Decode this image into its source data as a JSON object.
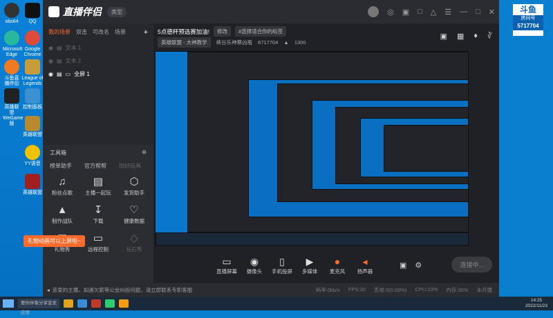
{
  "app": {
    "name": "直播伴侣",
    "type_chip": "类型"
  },
  "desktop_icons": [
    {
      "label": "obs64"
    },
    {
      "label": "QQ"
    },
    {
      "label": "Microsoft Edge"
    },
    {
      "label": "Google Chrome"
    },
    {
      "label": "斗鱼直播伴侣"
    },
    {
      "label": "League of Legends"
    },
    {
      "label": "英雄联盟WeGame版"
    },
    {
      "label": "控制面板"
    },
    {
      "label": "英雄联盟"
    },
    {
      "label": "YY语音"
    },
    {
      "label": "英雄联盟"
    }
  ],
  "left_panel": {
    "scene_tabs": [
      "我的场景",
      "双击",
      "可改名",
      "场景"
    ],
    "add_label": "+",
    "scenes": [
      {
        "label": "文本 1"
      },
      {
        "label": "文本 2"
      },
      {
        "label": "全屏 1"
      }
    ]
  },
  "toolbox": {
    "title": "工具箱",
    "tabs": [
      "榜单助手",
      "官方帮帮",
      "加好玩具"
    ],
    "items": [
      {
        "label": "粉丝点歌",
        "icon": "guitar-icon"
      },
      {
        "label": "主播一起玩",
        "icon": "list-icon"
      },
      {
        "label": "发货助手",
        "icon": "cube-icon"
      },
      {
        "label": "制作战队",
        "icon": "team-icon"
      },
      {
        "label": "下载",
        "icon": "download-icon"
      },
      {
        "label": "健康数据",
        "icon": "heart-icon"
      },
      {
        "label": "礼物秀",
        "icon": "gift-icon"
      },
      {
        "label": "远程控制",
        "icon": "screen-icon"
      },
      {
        "label": "钻石秀",
        "icon": "diamond-icon"
      }
    ],
    "gift_tip": "礼物动画可以上屏啦~"
  },
  "stream_info": {
    "title": "5点德杯预选赛加油!",
    "edit_label": "修改",
    "tag_label": "#选择适合你的标签",
    "category": "英雄联盟 - 大神教学",
    "location": "峡谷乐神蔡凶瓶",
    "room_id": "6717704",
    "heat": "1300"
  },
  "bottom_tools": [
    {
      "label": "直播屏幕",
      "icon": "screen-icon"
    },
    {
      "label": "摄像头",
      "icon": "camera-icon"
    },
    {
      "label": "手机投屏",
      "icon": "phone-icon"
    },
    {
      "label": "多媒体",
      "icon": "media-icon"
    },
    {
      "label": "麦克风",
      "icon": "mic-icon"
    },
    {
      "label": "扬声器",
      "icon": "speaker-icon"
    }
  ],
  "go_live_label": "连接中...",
  "status_bar": {
    "notice": "亲爱的主播，如遇欠薪等公会纠纷问题，请立即联系专职客服",
    "stats": [
      "码率:0kb/s",
      "FPS:30",
      "丢帧:0(0.00%)",
      "CPU:23%",
      "内存:30%",
      "未开播"
    ]
  },
  "room_badge": {
    "brand": "斗鱼",
    "label": "房间号",
    "id": "5717704"
  },
  "taskbar": {
    "search": "要你伴客分享宣发应用",
    "time": "14:25",
    "date": "2022/11/23"
  }
}
